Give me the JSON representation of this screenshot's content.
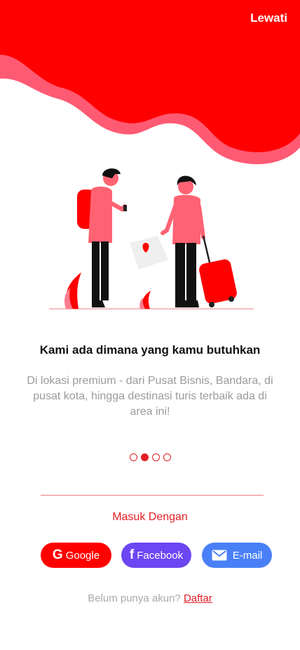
{
  "header": {
    "skip_label": "Lewati"
  },
  "onboarding": {
    "title": "Kami ada dimana yang kamu butuhkan",
    "description": "Di lokasi premium - dari Pusat Bisnis, Bandara, di pusat kota, hingga destinasi turis terbaik ada di area ini!",
    "pages_total": 4,
    "active_page": 2
  },
  "login": {
    "heading": "Masuk Dengan",
    "buttons": [
      {
        "label": "Google",
        "icon": "google-icon",
        "color": "#ff0000"
      },
      {
        "label": "Facebook",
        "icon": "facebook-icon",
        "color": "#6b46f2"
      },
      {
        "label": "E-mail",
        "icon": "mail-icon",
        "color": "#4a80f7"
      }
    ]
  },
  "signup": {
    "prompt": "Belum punya akun?",
    "link_label": "Daftar"
  },
  "colors": {
    "accent": "#ff0000",
    "blob_outline": "#ff5a73",
    "text_muted": "#9b9b9b"
  }
}
